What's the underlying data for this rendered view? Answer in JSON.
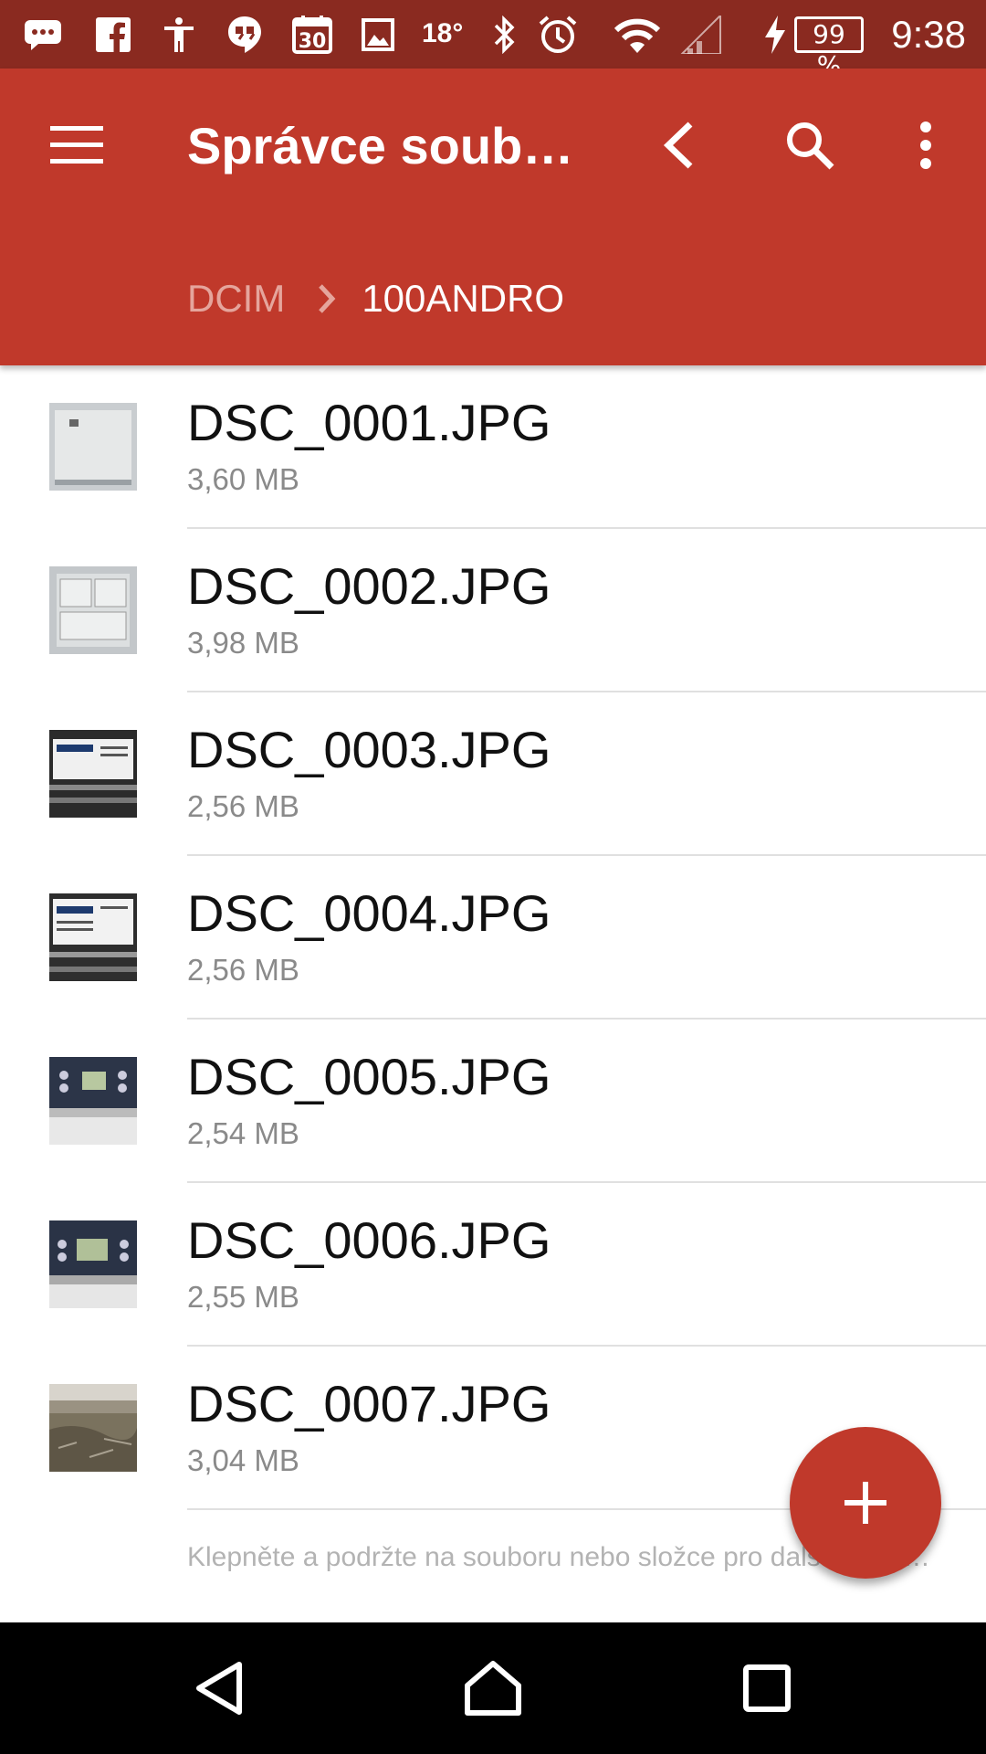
{
  "status_bar": {
    "time": "9:38",
    "battery": "99 %",
    "temperature": "18°",
    "icons": [
      "messages-icon",
      "facebook-icon",
      "accessibility-icon",
      "hangouts-icon",
      "calendar-icon",
      "gallery-icon",
      "bluetooth-icon",
      "alarm-icon",
      "wifi-icon",
      "signal-icon",
      "charging-icon"
    ],
    "calendar_day": "30"
  },
  "app_bar": {
    "title": "Správce soubo…",
    "breadcrumb": {
      "parent": "DCIM",
      "current": "100ANDRO"
    },
    "icons": {
      "menu": "menu-icon",
      "back": "chevron-left-icon",
      "search": "search-icon",
      "more": "more-vert-icon"
    }
  },
  "files": [
    {
      "name": "DSC_0001.JPG",
      "size": "3,60 MB"
    },
    {
      "name": "DSC_0002.JPG",
      "size": "3,98 MB"
    },
    {
      "name": "DSC_0003.JPG",
      "size": "2,56 MB"
    },
    {
      "name": "DSC_0004.JPG",
      "size": "2,56 MB"
    },
    {
      "name": "DSC_0005.JPG",
      "size": "2,54 MB"
    },
    {
      "name": "DSC_0006.JPG",
      "size": "2,55 MB"
    },
    {
      "name": "DSC_0007.JPG",
      "size": "3,04 MB"
    }
  ],
  "hint": "Klepněte a podržte na souboru nebo složce pro další možn…",
  "fab": {
    "icon": "plus-icon"
  },
  "nav_bar": {
    "icons": [
      "back-triangle-icon",
      "home-icon",
      "recents-icon"
    ]
  },
  "colors": {
    "primary": "#c0392b",
    "status_bar": "#8a2a20",
    "text_primary": "#111111",
    "text_secondary": "#8a8a8a",
    "hint": "#b3b3b3"
  }
}
